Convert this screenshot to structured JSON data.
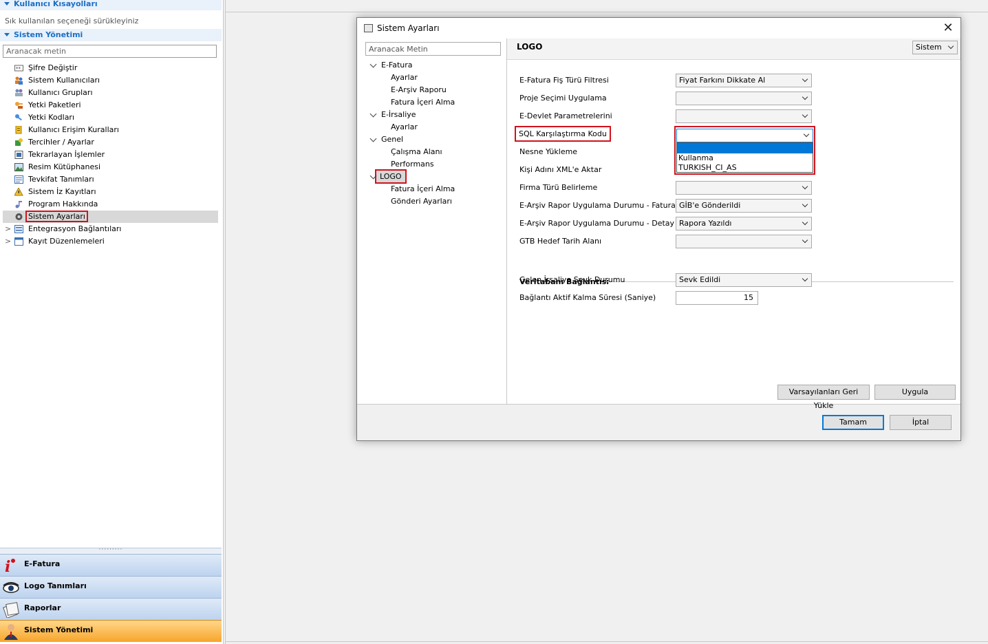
{
  "left_panel": {
    "shortcuts_header": "Kullanıcı Kısayolları",
    "shortcuts_hint": "Sık kullanılan seçeneği sürükleyiniz",
    "admin_header": "Sistem Yönetimi",
    "search_placeholder": "Aranacak metin",
    "items": [
      {
        "label": "Şifre Değiştir",
        "icon": "password-icon"
      },
      {
        "label": "Sistem Kullanıcıları",
        "icon": "users-icon"
      },
      {
        "label": "Kullanıcı Grupları",
        "icon": "user-groups-icon"
      },
      {
        "label": "Yetki Paketleri",
        "icon": "key-package-icon"
      },
      {
        "label": "Yetki Kodları",
        "icon": "key-icon"
      },
      {
        "label": "Kullanıcı Erişim Kuralları",
        "icon": "access-rules-icon"
      },
      {
        "label": "Tercihler / Ayarlar",
        "icon": "preferences-icon"
      },
      {
        "label": "Tekrarlayan İşlemler",
        "icon": "recurring-icon"
      },
      {
        "label": "Resim Kütüphanesi",
        "icon": "image-library-icon"
      },
      {
        "label": "Tevkifat Tanımları",
        "icon": "withholding-icon"
      },
      {
        "label": "Sistem İz Kayıtları",
        "icon": "audit-log-icon"
      },
      {
        "label": "Program Hakkında",
        "icon": "about-icon"
      },
      {
        "label": "Sistem Ayarları",
        "icon": "settings-gear-icon"
      },
      {
        "label": "Entegrasyon Bağlantıları",
        "icon": "integration-icon"
      },
      {
        "label": "Kayıt Düzenlemeleri",
        "icon": "record-edit-icon"
      }
    ],
    "nav_buttons": [
      {
        "label": "E-Fatura",
        "icon": "efatura-logo-icon"
      },
      {
        "label": "Logo Tanımları",
        "icon": "logo-eye-icon"
      },
      {
        "label": "Raporlar",
        "icon": "reports-icon"
      },
      {
        "label": "Sistem Yönetimi",
        "icon": "admin-person-icon"
      }
    ]
  },
  "dialog": {
    "title": "Sistem Ayarları",
    "close_glyph": "✕",
    "nav_search_placeholder": "Aranacak Metin",
    "tree": {
      "efatura": "E-Fatura",
      "efatura_ayarlar": "Ayarlar",
      "efatura_earsiv": "E-Arşiv Raporu",
      "efatura_icerialma": "Fatura İçeri Alma",
      "eirsaliye": "E-İrsaliye",
      "eirsaliye_ayarlar": "Ayarlar",
      "genel": "Genel",
      "genel_calisma": "Çalışma Alanı",
      "genel_performans": "Performans",
      "logo": "LOGO",
      "logo_icerialma": "Fatura İçeri Alma",
      "logo_gonderi": "Gönderi Ayarları"
    },
    "content_title": "LOGO",
    "scope_value": "Sistem",
    "fields": [
      {
        "label": "E-Fatura Fiş Türü Filtresi",
        "value": "Fiyat Farkını Dikkate Al"
      },
      {
        "label": "Proje Seçimi Uygulama",
        "value": ""
      },
      {
        "label": "E-Devlet Parametrelerini",
        "value": ""
      },
      {
        "label": "SQL Karşılaştırma Kodu",
        "value": ""
      },
      {
        "label": "Nesne Yükleme",
        "value": ""
      },
      {
        "label": "Kişi Adını XML'e Aktar",
        "value": ""
      },
      {
        "label": "Firma Türü Belirleme",
        "value": ""
      },
      {
        "label": "E-Arşiv Rapor Uygulama Durumu - Fatura",
        "value": "GİB'e Gönderildi"
      },
      {
        "label": "E-Arşiv Rapor Uygulama Durumu - Detay",
        "value": "Rapora Yazıldı"
      },
      {
        "label": "GTB Hedef Tarih Alanı",
        "value": ""
      }
    ],
    "sql_options": [
      "Kullanma",
      "TURKISH_CI_AS"
    ],
    "db_section_title": "Veritabanı Bağlantısı",
    "db_fields": {
      "shipment_label": "Gelen İrsaliye Sevk Durumu",
      "shipment_value": "Sevk Edildi",
      "timeout_label": "Bağlantı Aktif Kalma Süresi (Saniye)",
      "timeout_value": "15"
    },
    "buttons": {
      "restore_defaults": "Varsayılanları Geri Yükle",
      "apply": "Uygula",
      "ok": "Tamam",
      "cancel": "İptal"
    }
  },
  "colors": {
    "accent": "#0078d7",
    "highlight_box": "#d0121b",
    "header_text": "#1a6fc4",
    "active_nav": "#f7a52b"
  }
}
